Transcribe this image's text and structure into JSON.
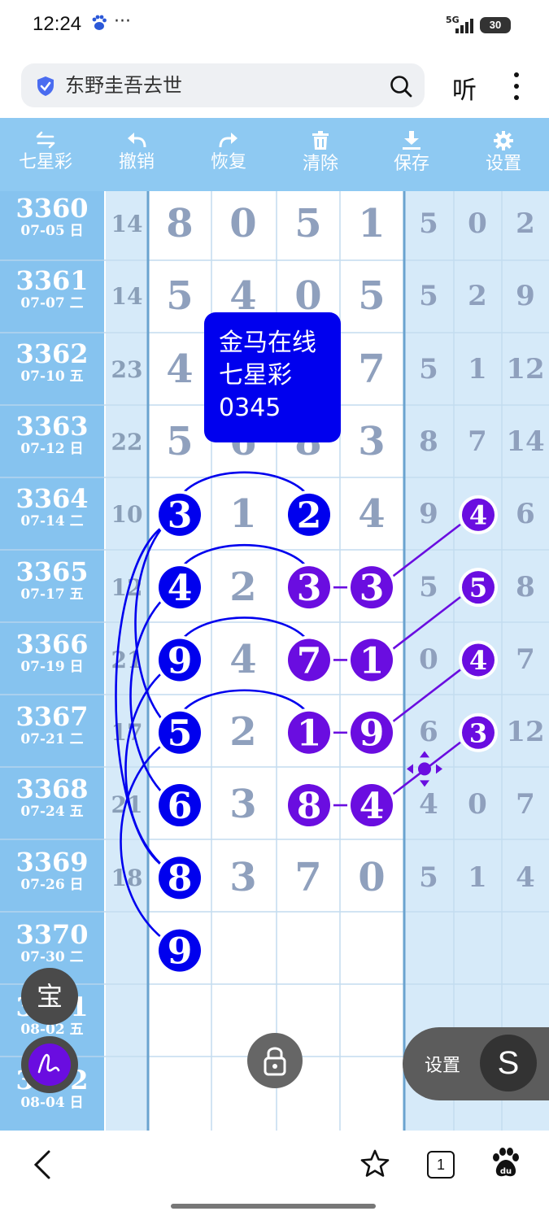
{
  "status_bar": {
    "time": "12:24",
    "more": "···",
    "network": "5G",
    "battery": "30"
  },
  "search": {
    "query": "东野圭吾去世"
  },
  "header": {
    "listen_label": "听"
  },
  "toolbar": {
    "items": [
      {
        "label": "七星彩",
        "icon": "swap-icon"
      },
      {
        "label": "撤销",
        "icon": "undo-icon"
      },
      {
        "label": "恢复",
        "icon": "redo-icon"
      },
      {
        "label": "清除",
        "icon": "trash-icon"
      },
      {
        "label": "保存",
        "icon": "download-icon"
      },
      {
        "label": "设置",
        "icon": "gear-icon"
      }
    ]
  },
  "rows": [
    {
      "issue": "3360",
      "date": "07-05 日",
      "sum": "14",
      "digits": [
        "8",
        "0",
        "5",
        "1"
      ],
      "right": [
        "5",
        "0",
        "2"
      ]
    },
    {
      "issue": "3361",
      "date": "07-07 二",
      "sum": "14",
      "digits": [
        "5",
        "4",
        "0",
        "5"
      ],
      "right": [
        "5",
        "2",
        "9"
      ]
    },
    {
      "issue": "3362",
      "date": "07-10 五",
      "sum": "23",
      "digits": [
        "4",
        "",
        "",
        "7"
      ],
      "right": [
        "5",
        "1",
        "12"
      ]
    },
    {
      "issue": "3363",
      "date": "07-12 日",
      "sum": "22",
      "digits": [
        "5",
        "6",
        "8",
        "3"
      ],
      "right": [
        "8",
        "7",
        "14"
      ]
    },
    {
      "issue": "3364",
      "date": "07-14 二",
      "sum": "10",
      "digits": [
        "3",
        "1",
        "2",
        "4"
      ],
      "right": [
        "9",
        "4",
        "6"
      ]
    },
    {
      "issue": "3365",
      "date": "07-17 五",
      "sum": "12",
      "digits": [
        "4",
        "2",
        "3",
        "3"
      ],
      "right": [
        "5",
        "5",
        "8"
      ]
    },
    {
      "issue": "3366",
      "date": "07-19 日",
      "sum": "21",
      "digits": [
        "9",
        "4",
        "7",
        "1"
      ],
      "right": [
        "0",
        "4",
        "7"
      ]
    },
    {
      "issue": "3367",
      "date": "07-21 二",
      "sum": "17",
      "digits": [
        "5",
        "2",
        "1",
        "9"
      ],
      "right": [
        "6",
        "3",
        "12"
      ]
    },
    {
      "issue": "3368",
      "date": "07-24 五",
      "sum": "21",
      "digits": [
        "6",
        "3",
        "8",
        "4"
      ],
      "right": [
        "4",
        "0",
        "7"
      ]
    },
    {
      "issue": "3369",
      "date": "07-26 日",
      "sum": "18",
      "digits": [
        "8",
        "3",
        "7",
        "0"
      ],
      "right": [
        "5",
        "1",
        "4"
      ]
    },
    {
      "issue": "3370",
      "date": "07-30 二",
      "sum": "",
      "digits": [
        "9",
        "",
        "",
        ""
      ],
      "right": [
        "",
        "",
        ""
      ]
    },
    {
      "issue": "3371",
      "date": "08-02 五",
      "sum": "",
      "digits": [
        "",
        "",
        "",
        ""
      ],
      "right": [
        "",
        "",
        ""
      ]
    },
    {
      "issue": "3372",
      "date": "08-04 日",
      "sum": "",
      "digits": [
        "",
        "",
        "",
        ""
      ],
      "right": [
        "",
        "",
        ""
      ]
    }
  ],
  "popup": {
    "line1": "金马在线",
    "line2": "七星彩",
    "line3": "0345"
  },
  "floating": {
    "bao_label": "宝",
    "settings_label": "设置",
    "s_label": "S"
  },
  "bottom_nav": {
    "tab_count": "1"
  },
  "colors": {
    "toolbar_bg": "#8ec9f2",
    "issue_bg": "#86c3ef",
    "pale_blue": "#d6eaf9",
    "blue_circle": "#0000ee",
    "purple_circle": "#6a0de0",
    "popup_bg": "#0000ee"
  }
}
